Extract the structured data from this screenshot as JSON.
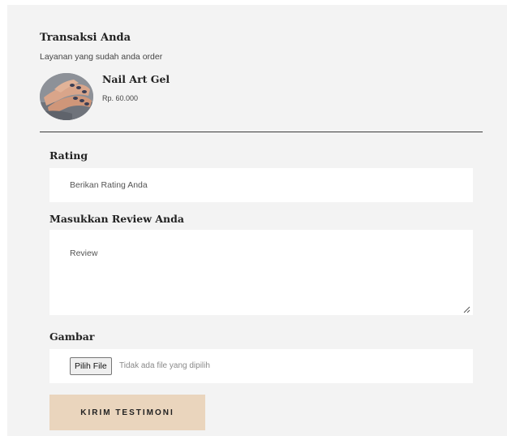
{
  "transaction": {
    "title": "Transaksi Anda",
    "subtitle": "Layanan yang sudah anda order",
    "service": {
      "name": "Nail Art Gel",
      "price": "Rp. 60.000",
      "image_icon": "nail-art-photo"
    }
  },
  "form": {
    "rating_label": "Rating",
    "rating_placeholder": "Berikan Rating Anda",
    "review_label": "Masukkan Review Anda",
    "review_placeholder": "Review",
    "image_label": "Gambar",
    "file_button_label": "Pilih File",
    "file_status": "Tidak ada file yang dipilih",
    "submit_label": "KIRIM TESTIMONI"
  },
  "colors": {
    "panel_bg": "#f3f3f3",
    "submit_bg": "#ead5bd"
  }
}
